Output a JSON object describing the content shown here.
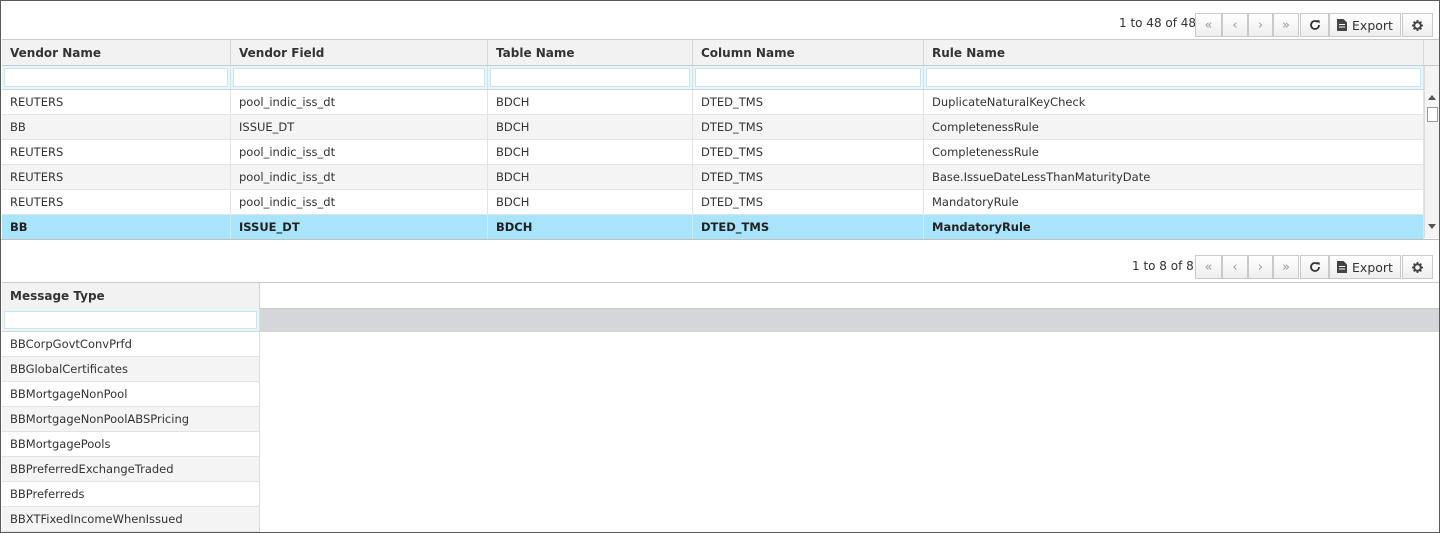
{
  "top_grid": {
    "pagination_text": "1 to 48 of 48",
    "export_label": "Export",
    "columns": [
      "Vendor Name",
      "Vendor Field",
      "Table Name",
      "Column Name",
      "Rule Name"
    ],
    "rows": [
      [
        "REUTERS",
        "pool_indic_iss_dt",
        "BDCH",
        "DTED_TMS",
        "DuplicateNaturalKeyCheck"
      ],
      [
        "BB",
        "ISSUE_DT",
        "BDCH",
        "DTED_TMS",
        "CompletenessRule"
      ],
      [
        "REUTERS",
        "pool_indic_iss_dt",
        "BDCH",
        "DTED_TMS",
        "CompletenessRule"
      ],
      [
        "REUTERS",
        "pool_indic_iss_dt",
        "BDCH",
        "DTED_TMS",
        "Base.IssueDateLessThanMaturityDate"
      ],
      [
        "REUTERS",
        "pool_indic_iss_dt",
        "BDCH",
        "DTED_TMS",
        "MandatoryRule"
      ],
      [
        "BB",
        "ISSUE_DT",
        "BDCH",
        "DTED_TMS",
        "MandatoryRule"
      ]
    ],
    "selected_row": 5
  },
  "bottom_grid": {
    "pagination_text": "1 to 8 of 8",
    "export_label": "Export",
    "columns": [
      "Message Type"
    ],
    "rows": [
      "BBCorpGovtConvPrfd",
      "BBGlobalCertificates",
      "BBMortgageNonPool",
      "BBMortgageNonPoolABSPricing",
      "BBMortgagePools",
      "BBPreferredExchangeTraded",
      "BBPreferreds",
      "BBXTFixedIncomeWhenIssued"
    ]
  },
  "icons": {
    "first_page": "double-chevron-left-icon",
    "prev_page": "chevron-left-icon",
    "next_page": "chevron-right-icon",
    "last_page": "double-chevron-right-icon",
    "refresh": "refresh-icon",
    "export": "document-icon",
    "settings": "gear-icon"
  },
  "colors": {
    "selected_row": "#a8e4fb",
    "filter_row": "#e5f6fd",
    "header_bg": "#f2f2f2",
    "alt_row": "#f4f4f4"
  }
}
